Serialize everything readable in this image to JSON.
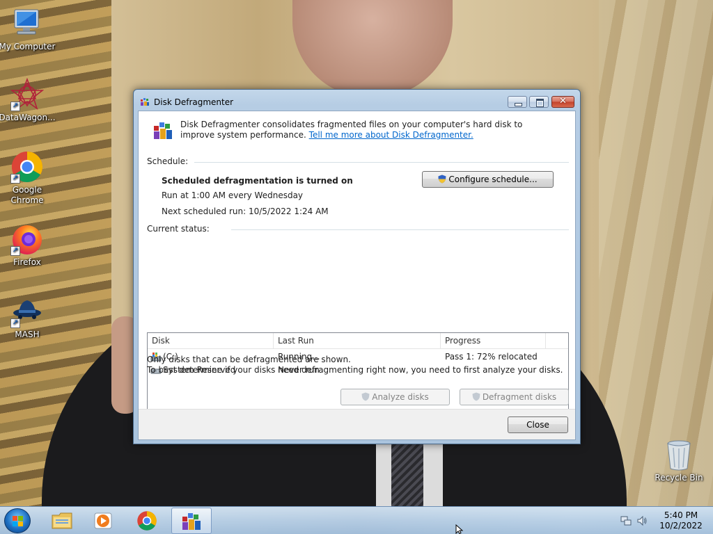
{
  "desktop": {
    "icons": [
      {
        "label": "My Computer",
        "icon": "computer-icon"
      },
      {
        "label": "DataWagon...",
        "icon": "datawagon-icon"
      },
      {
        "label": "Google Chrome",
        "icon": "chrome-icon"
      },
      {
        "label": "Firefox",
        "icon": "firefox-icon"
      },
      {
        "label": "MASH",
        "icon": "mash-icon"
      },
      {
        "label": "Recycle Bin",
        "icon": "recycle-bin-icon"
      }
    ]
  },
  "dialog": {
    "title": "Disk Defragmenter",
    "intro": "Disk Defragmenter consolidates fragmented files on your computer's hard disk to improve system performance.",
    "intro_link": "Tell me more about Disk Defragmenter.",
    "schedule": {
      "label": "Schedule:",
      "status": "Scheduled defragmentation is turned on",
      "run_at": "Run at 1:00 AM every Wednesday",
      "next_run": "Next scheduled run: 10/5/2022 1:24 AM",
      "configure_button": "Configure schedule..."
    },
    "current_status": {
      "label": "Current status:",
      "columns": [
        "Disk",
        "Last Run",
        "Progress"
      ],
      "rows": [
        {
          "disk": "(C:)",
          "last_run": "Running...",
          "progress": "Pass 1: 72% relocated"
        },
        {
          "disk": "System Reserved",
          "last_run": "Never run",
          "progress": ""
        }
      ]
    },
    "notes": [
      "Only disks that can be defragmented are shown.",
      "To best determine if your disks need defragmenting right now, you need to first analyze your disks."
    ],
    "analyze_button": "Analyze disks",
    "defrag_button": "Defragment disks",
    "close_button": "Close"
  },
  "taskbar": {
    "items": [
      "start-orb-icon",
      "file-explorer-icon",
      "media-player-icon",
      "chrome-icon",
      "disk-defragmenter-icon"
    ],
    "clock_time": "5:40 PM",
    "clock_date": "10/2/2022"
  },
  "colors": {
    "link": "#0066cc",
    "title_text": "#000000",
    "taskbar": "#b9d2eb"
  }
}
